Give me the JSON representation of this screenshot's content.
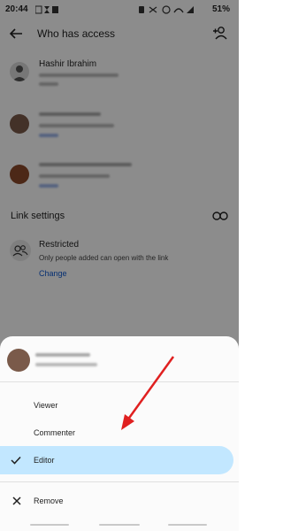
{
  "status_bar": {
    "time": "20:44",
    "battery": "51%"
  },
  "header": {
    "title": "Who has access"
  },
  "people": [
    {
      "name": "Hashir Ibrahim"
    },
    {
      "name": ""
    },
    {
      "name": ""
    }
  ],
  "link_settings": {
    "heading": "Link settings",
    "mode": "Restricted",
    "description": "Only people added can open with the link",
    "change_label": "Change"
  },
  "sheet": {
    "items": [
      {
        "label": "Viewer",
        "selected": false
      },
      {
        "label": "Commenter",
        "selected": false
      },
      {
        "label": "Editor",
        "selected": true
      },
      {
        "label": "Remove",
        "selected": false
      }
    ]
  },
  "colors": {
    "accent": "#0b57d0",
    "selected_bg": "#c2e7ff",
    "arrow": "#e02020"
  }
}
